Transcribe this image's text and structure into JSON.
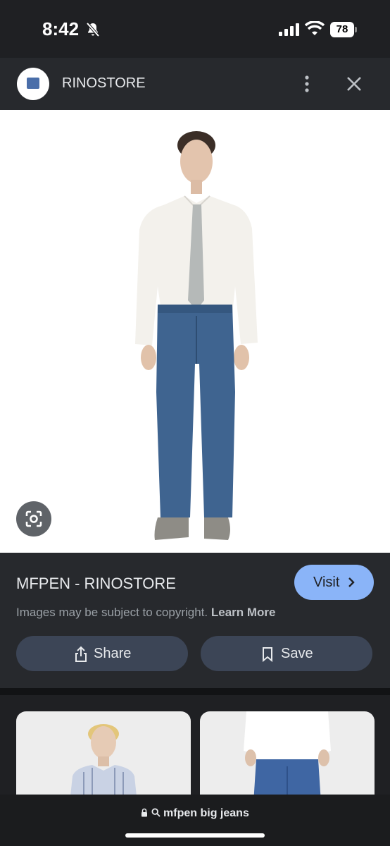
{
  "status_bar": {
    "time": "8:42",
    "battery": "78"
  },
  "header": {
    "site_name": "RINOSTORE"
  },
  "result": {
    "title": "MFPEN - RINOSTORE",
    "visit_label": "Visit",
    "copyright_text": "Images may be subject to copyright.",
    "learn_more": "Learn More",
    "share_label": "Share",
    "save_label": "Save"
  },
  "address_bar": {
    "url": "mfpen big jeans"
  },
  "colors": {
    "accent": "#8ab4f8",
    "button_bg": "#3c4556",
    "panel_bg": "#27292d"
  },
  "icons": [
    "bell-slash-icon",
    "signal-icon",
    "wifi-icon",
    "battery-icon",
    "more-vert-icon",
    "close-icon",
    "lens-icon",
    "chevron-right-icon",
    "share-icon",
    "bookmark-icon",
    "lock-icon",
    "search-icon"
  ]
}
